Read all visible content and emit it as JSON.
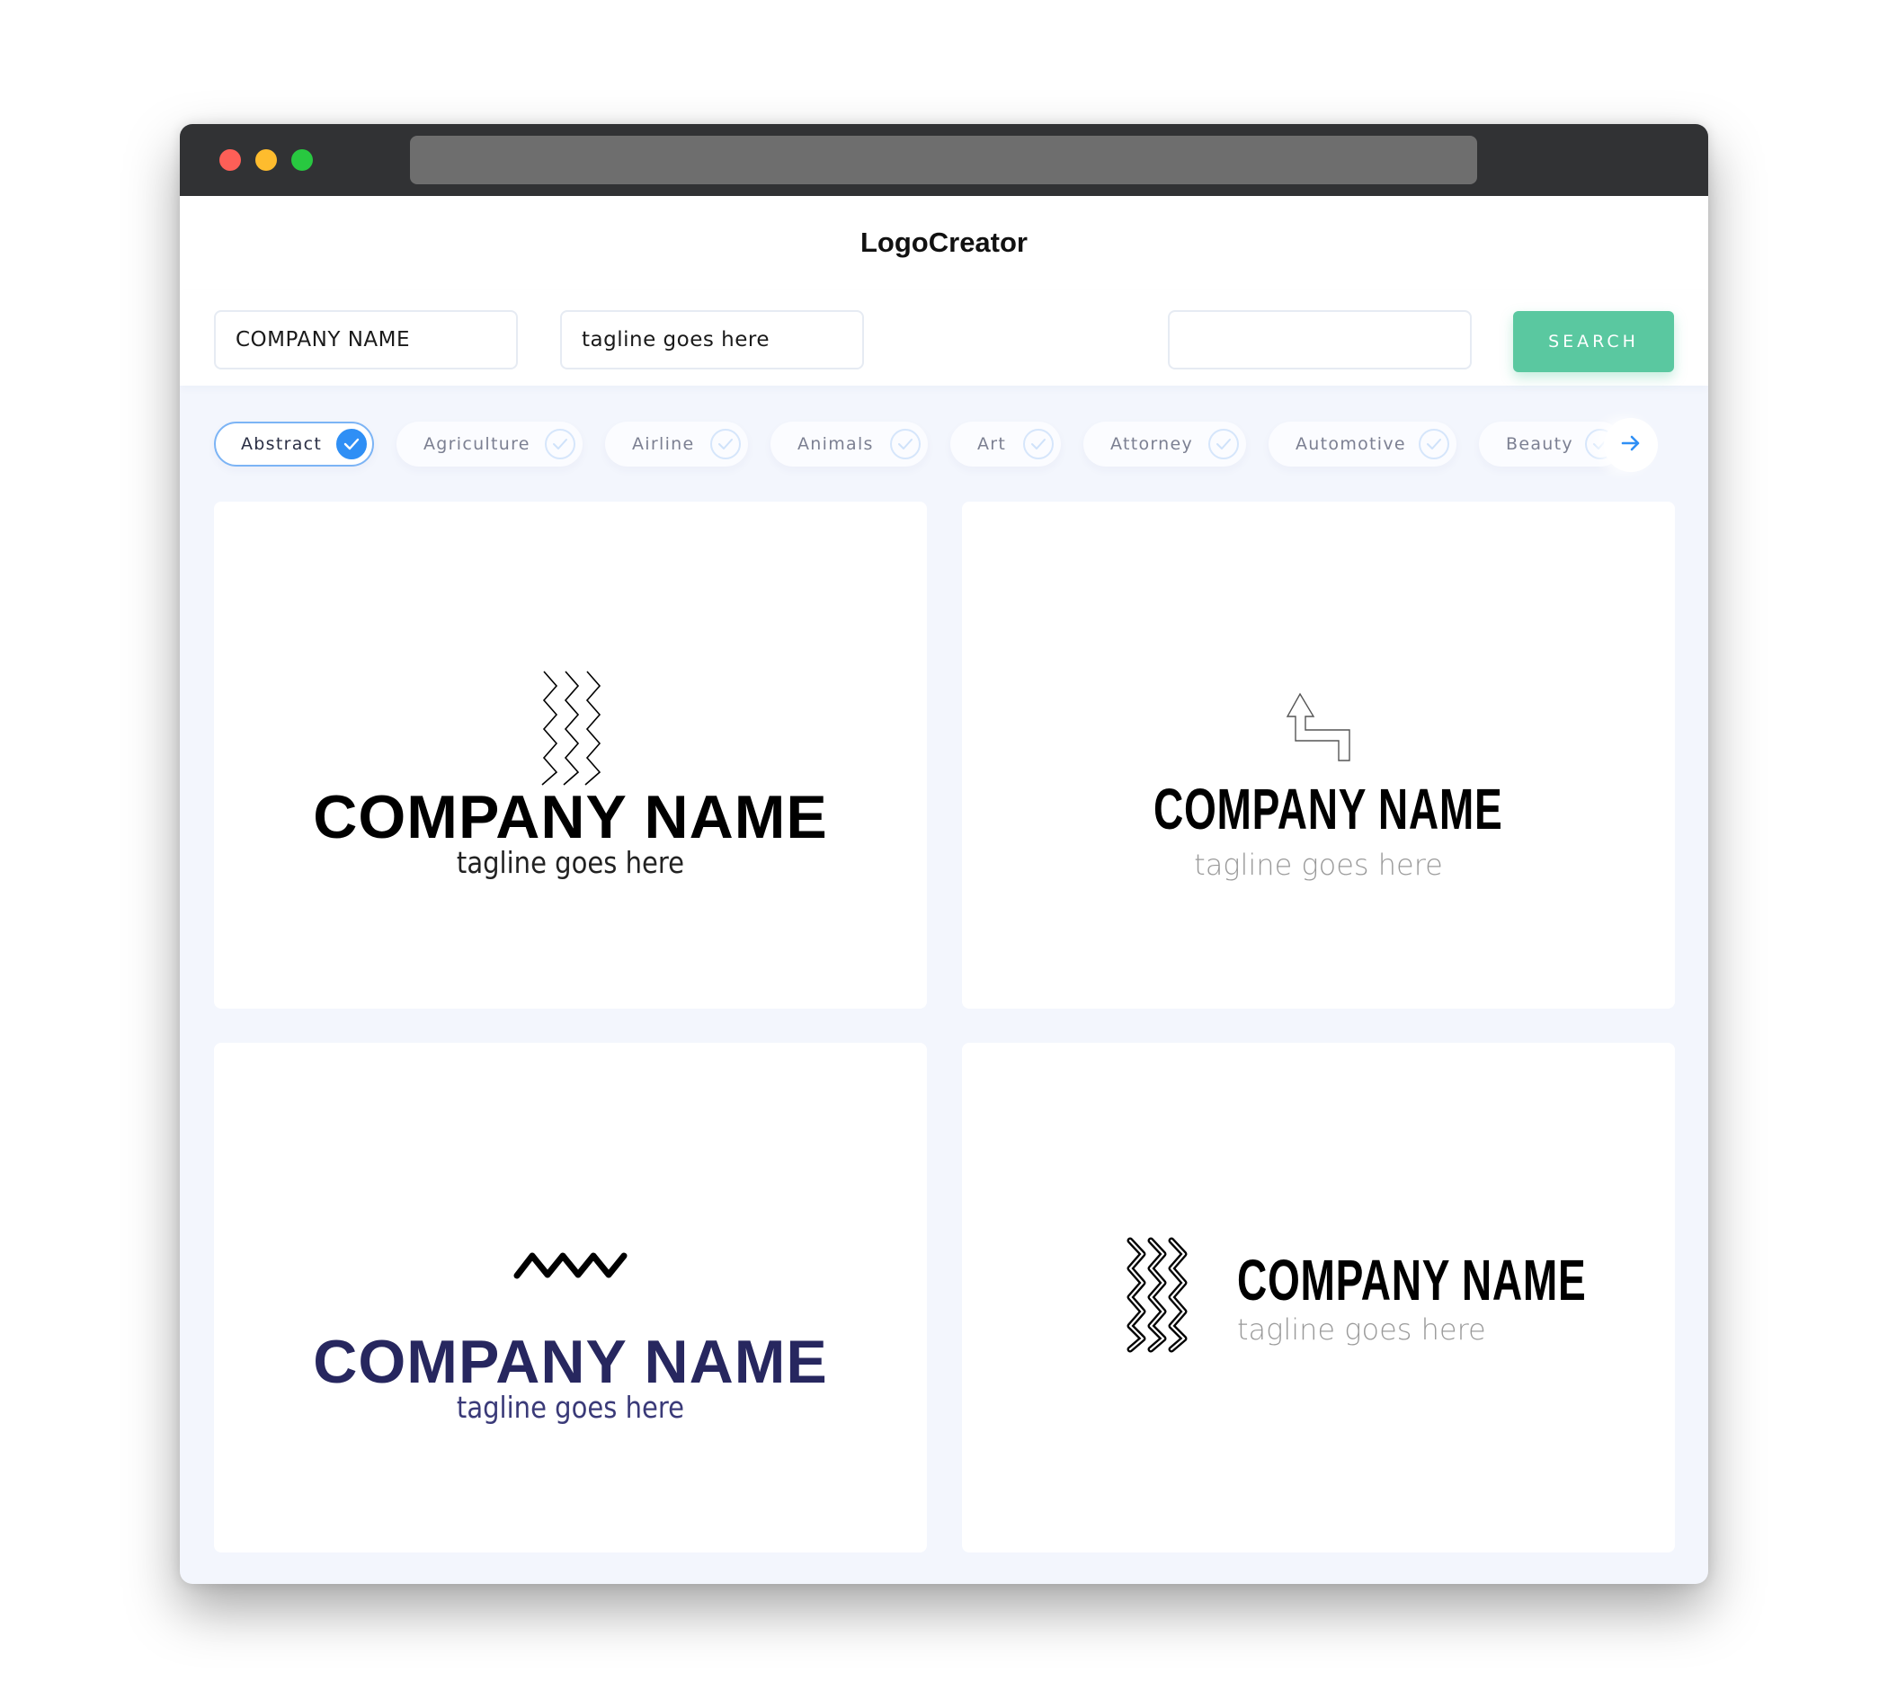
{
  "window": {
    "controls": [
      "close",
      "minimize",
      "maximize"
    ]
  },
  "header": {
    "brand": "LogoCreator"
  },
  "search": {
    "company_name_value": "COMPANY NAME",
    "tagline_value": "tagline goes here",
    "keyword_value": "",
    "button_label": "SEARCH"
  },
  "categories": {
    "items": [
      {
        "label": "Abstract",
        "selected": true
      },
      {
        "label": "Agriculture",
        "selected": false
      },
      {
        "label": "Airline",
        "selected": false
      },
      {
        "label": "Animals",
        "selected": false
      },
      {
        "label": "Art",
        "selected": false
      },
      {
        "label": "Attorney",
        "selected": false
      },
      {
        "label": "Automotive",
        "selected": false
      },
      {
        "label": "Beauty",
        "selected": false
      }
    ],
    "next_icon": "arrow-right-icon"
  },
  "colors": {
    "accent_green": "#5ac8a0",
    "accent_blue": "#2f8ff5",
    "navy": "#27275f",
    "page_bg": "#f3f6fd"
  },
  "logos": [
    {
      "icon": "triple-zigzag-lines-icon",
      "company": "COMPANY NAME",
      "tagline": "tagline goes here",
      "layout": "stacked",
      "name_color": "#000000",
      "tagline_color": "#222222"
    },
    {
      "icon": "stepped-arrow-up-icon",
      "company": "COMPANY NAME",
      "tagline": "tagline goes here",
      "layout": "stacked",
      "name_color": "#000000",
      "tagline_color": "#9a9a9a"
    },
    {
      "icon": "wave-zigzag-icon",
      "company": "COMPANY NAME",
      "tagline": "tagline goes here",
      "layout": "stacked",
      "name_color": "#27275f",
      "tagline_color": "#3a3a78"
    },
    {
      "icon": "outlined-zigzag-lines-icon",
      "company": "COMPANY NAME",
      "tagline": "tagline goes here",
      "layout": "inline",
      "name_color": "#000000",
      "tagline_color": "#9a9a9a"
    }
  ]
}
